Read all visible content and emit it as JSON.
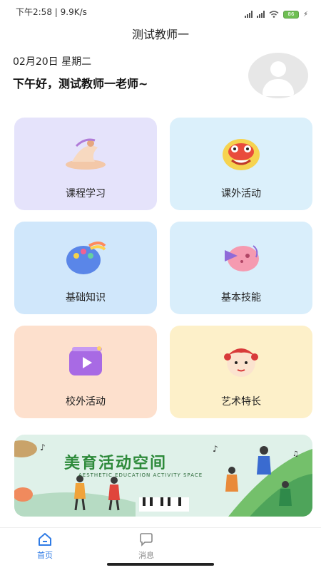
{
  "status": {
    "time": "下午2:58 | 9.9K/s",
    "battery": "86"
  },
  "header": {
    "title": "测试教师一"
  },
  "greeting": {
    "date": "02月20日 星期二",
    "text": "下午好，测试教师一老师~"
  },
  "menu": [
    {
      "label": "课程学习",
      "icon": "dancer-icon"
    },
    {
      "label": "课外活动",
      "icon": "lion-dance-icon"
    },
    {
      "label": "基础知识",
      "icon": "palette-icon"
    },
    {
      "label": "基本技能",
      "icon": "conch-icon"
    },
    {
      "label": "校外活动",
      "icon": "video-play-icon"
    },
    {
      "label": "艺术特长",
      "icon": "opera-mask-icon"
    }
  ],
  "banner": {
    "title": "美育活动空间",
    "subtitle": "AESTHETIC EDUCATION ACTIVITY SPACE"
  },
  "tabs": [
    {
      "label": "首页",
      "icon": "home-icon"
    },
    {
      "label": "消息",
      "icon": "chat-icon"
    }
  ]
}
